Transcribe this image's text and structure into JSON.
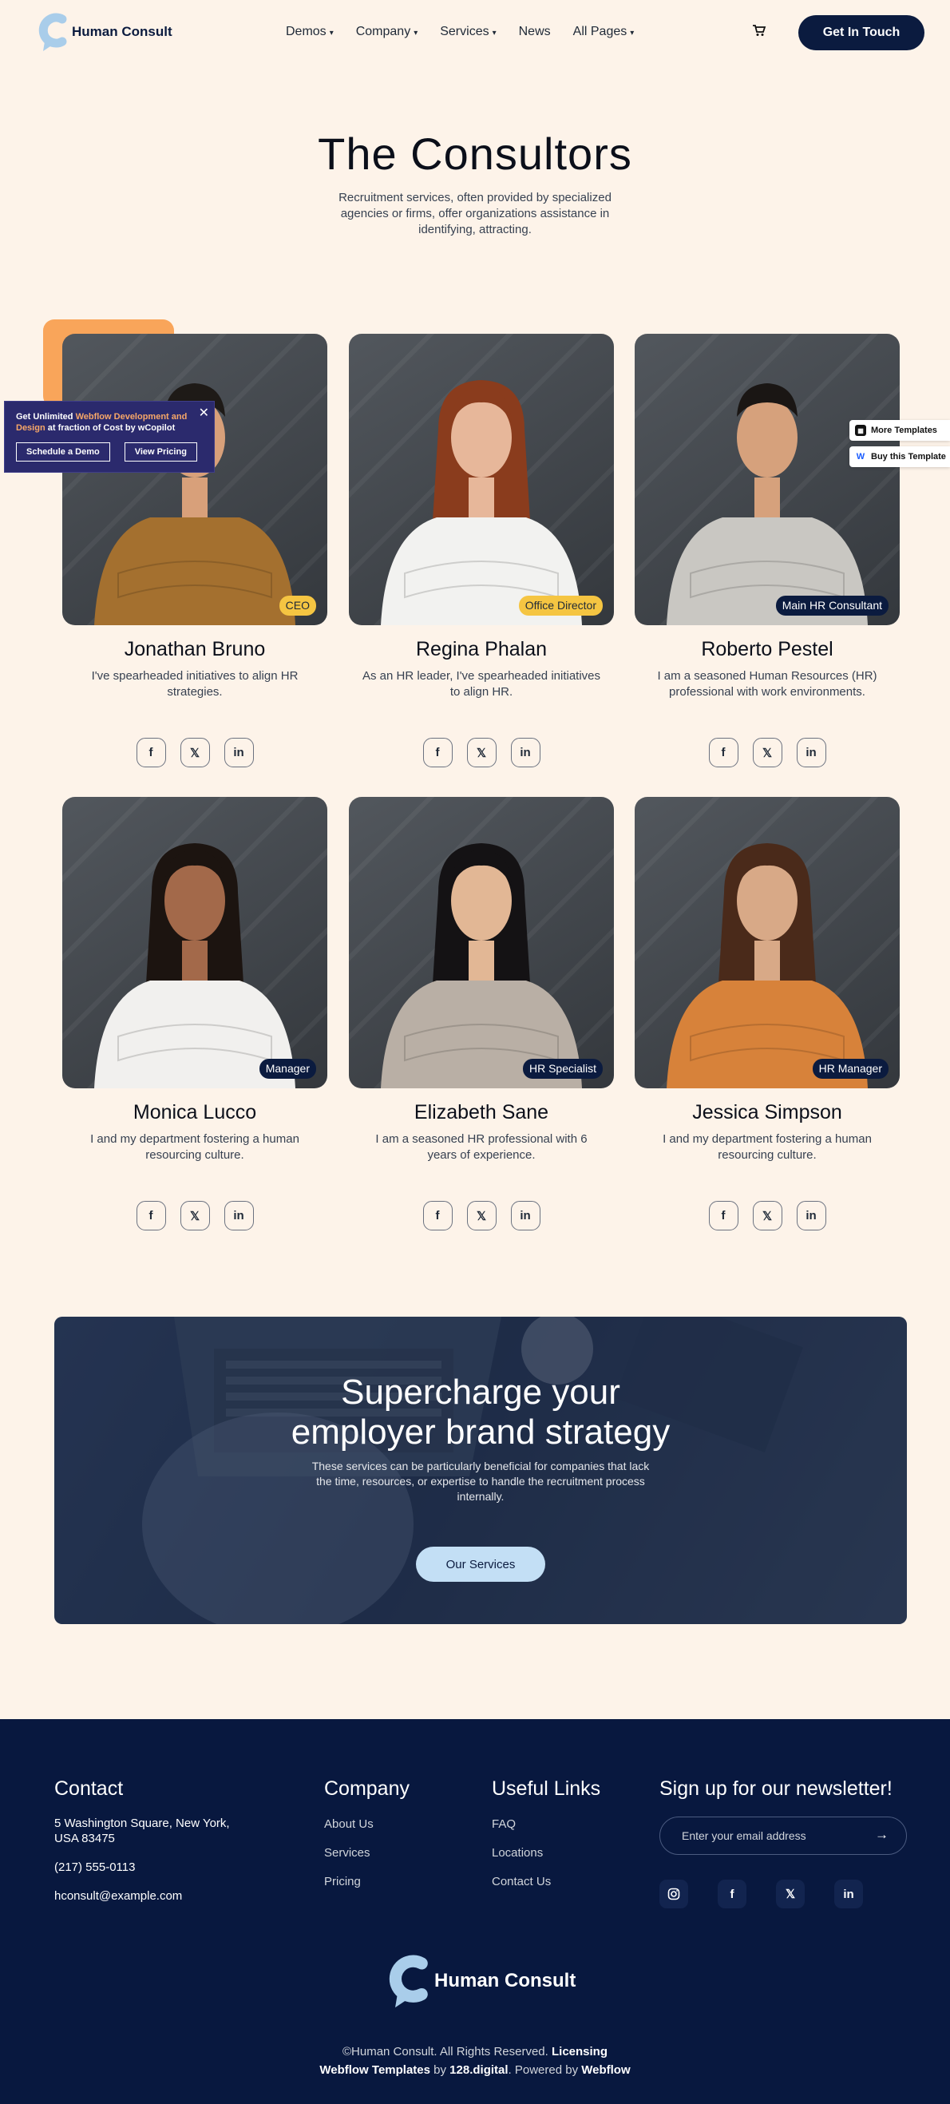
{
  "nav": {
    "brand": "Human Consult",
    "menu": [
      {
        "label": "Demos",
        "has_dropdown": true
      },
      {
        "label": "Company",
        "has_dropdown": true
      },
      {
        "label": "Services",
        "has_dropdown": true
      },
      {
        "label": "News",
        "has_dropdown": false
      },
      {
        "label": "All Pages",
        "has_dropdown": true
      }
    ],
    "cart_icon": "cart-icon",
    "cta_label": "Get In Touch"
  },
  "hero": {
    "title": "The Consultors",
    "subtitle": "Recruitment services, often provided by specialized agencies or firms, offer organizations assistance in identifying, attracting."
  },
  "team": [
    {
      "name": "Jonathan Bruno",
      "role": "CEO",
      "badge_style": "yellow",
      "bio": "I've spearheaded initiatives to align HR strategies.",
      "shirt": "#a4702f",
      "skin": "#d8a07a",
      "hair": "#1e1a17",
      "long_hair": false
    },
    {
      "name": "Regina Phalan",
      "role": "Office Director",
      "badge_style": "yellow",
      "bio": "As an HR leader, I've spearheaded initiatives to align HR.",
      "shirt": "#f2f2f0",
      "skin": "#e7b79a",
      "hair": "#8a3c1d",
      "long_hair": true
    },
    {
      "name": "Roberto Pestel",
      "role": "Main HR Consultant",
      "badge_style": "navy",
      "bio": "I am a seasoned Human Resources (HR) professional with work environments.",
      "shirt": "#c9c7c2",
      "skin": "#d6a17c",
      "hair": "#1a1614",
      "long_hair": false
    },
    {
      "name": "Monica Lucco",
      "role": "Manager",
      "badge_style": "navy",
      "bio": "I and my department fostering a human resourcing culture.",
      "shirt": "#f1f0ee",
      "skin": "#a3694a",
      "hair": "#1c1410",
      "long_hair": true
    },
    {
      "name": "Elizabeth Sane",
      "role": "HR Specialist",
      "badge_style": "navy",
      "bio": "I am a seasoned HR professional with 6 years of experience.",
      "shirt": "#b9afa5",
      "skin": "#e2b795",
      "hair": "#141214",
      "long_hair": true
    },
    {
      "name": "Jessica Simpson",
      "role": "HR Manager",
      "badge_style": "navy",
      "bio": "I and my department fostering a human resourcing culture.",
      "shirt": "#d7823a",
      "skin": "#d8a987",
      "hair": "#4a2a1a",
      "long_hair": true
    }
  ],
  "popup": {
    "text_pre": "Get Unlimited ",
    "text_highlight": "Webflow Development and Design",
    "text_post": " at fraction of Cost by wCopilot",
    "btn_demo": "Schedule a Demo",
    "btn_pricing": "View Pricing"
  },
  "side_tabs": {
    "more_templates": "More Templates",
    "buy_template": "Buy this Template"
  },
  "banner": {
    "title_line1": "Supercharge your",
    "title_line2": "employer brand strategy",
    "subtitle": "These services can be particularly beneficial for companies that lack the time, resources, or expertise to handle the recruitment process internally.",
    "button": "Our Services"
  },
  "footer": {
    "contact_heading": "Contact",
    "address": "5 Washington Square, New York, USA 83475",
    "phone": "(217) 555-0113",
    "email": "hconsult@example.com",
    "company_heading": "Company",
    "company_links": [
      "About Us",
      "Services",
      "Pricing"
    ],
    "useful_heading": "Useful Links",
    "useful_links": [
      "FAQ",
      "Locations",
      "Contact Us"
    ],
    "newsletter_heading": "Sign up for our newsletter!",
    "email_placeholder": "Enter your email address",
    "brand": "Human Consult",
    "copyright_pre": "©Human Consult. All Rights Reserved. ",
    "licensing": "Licensing",
    "webflow_templates": "Webflow Templates",
    "by": " by ",
    "digital": "128.digital",
    "powered": ". Powered by ",
    "webflow": "Webflow"
  },
  "colors": {
    "background": "#fdf3e9",
    "navy": "#0b1b3f",
    "accent_orange": "#f9a55a",
    "badge_yellow": "#f5c542",
    "button_light_blue": "#c3dff5",
    "footer_bg": "#08183f"
  }
}
